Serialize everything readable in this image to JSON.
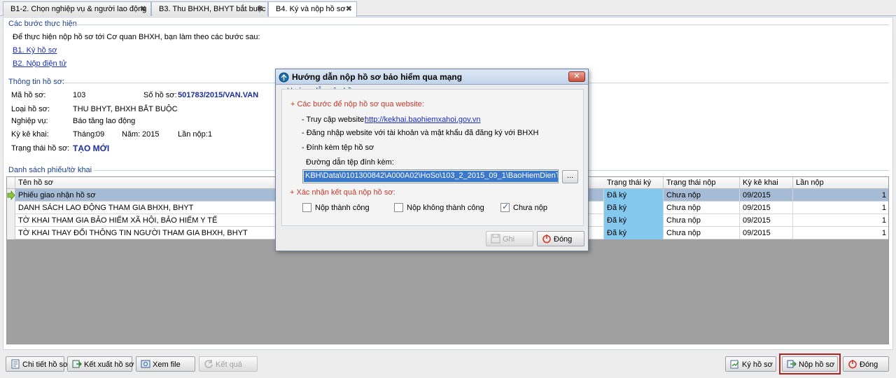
{
  "tabs": [
    {
      "label": "B1-2. Chọn nghiệp vụ & người lao động",
      "close": "✖"
    },
    {
      "label": "B3. Thu BHXH, BHYT bắt buộc",
      "close": "✖"
    },
    {
      "label": "B4. Ký và nộp hồ sơ",
      "close": "✖"
    }
  ],
  "steps": {
    "legend": "Các bước thực hiện",
    "intro": "Để thực hiện nộp hồ sơ tới Cơ quan BHXH, bạn làm theo các bước sau:",
    "step1": "B1. Ký hồ sơ",
    "step2": "B2. Nộp điện tử"
  },
  "info": {
    "legend": "Thông tin hồ sơ:",
    "ma_label": "Mã hồ sơ:",
    "ma_value": "103",
    "so_label": "Số hồ sơ:",
    "so_value": "501783/2015/VAN.VAN",
    "loai_label": "Loại hồ sơ:",
    "loai_value": "THU BHYT, BHXH BẮT BUỘC",
    "nv_label": "Nghiệp vụ:",
    "nv_value": "Báo tăng lao động",
    "ky_label": "Kỳ kê khai:",
    "thang_label": "Tháng:",
    "thang_value": "09",
    "nam_label": "Năm:",
    "nam_value": "2015",
    "lan_label": "Lần nộp:",
    "lan_value": "1",
    "tt_label": "Trạng thái hồ sơ:",
    "tt_value": "TẠO MỚI"
  },
  "list": {
    "legend": "Danh sách phiếu/tờ khai",
    "headers": {
      "name": "Tên hồ sơ",
      "ky": "Trạng thái ký",
      "nop": "Trạng thái nộp",
      "kykk": "Kỳ kê khai",
      "lan": "Lần nộp"
    },
    "rows": [
      {
        "name": "Phiếu giao nhận hồ sơ",
        "ky": "Đã ký",
        "nop": "Chưa nộp",
        "kykk": "09/2015",
        "lan": "1"
      },
      {
        "name": "DANH SÁCH LAO ĐỘNG THAM GIA BHXH, BHYT",
        "ky": "Đã ký",
        "nop": "Chưa nộp",
        "kykk": "09/2015",
        "lan": "1"
      },
      {
        "name": "TỜ KHAI THAM GIA BẢO HIỂM XÃ HỘI, BẢO HIỂM Y TẾ",
        "ky": "Đã ký",
        "nop": "Chưa nộp",
        "kykk": "09/2015",
        "lan": "1"
      },
      {
        "name": "TỜ KHAI THAY ĐỔI THÔNG TIN NGƯỜI THAM GIA BHXH, BHYT",
        "ky": "Đã ký",
        "nop": "Chưa nộp",
        "kykk": "09/2015",
        "lan": "1"
      }
    ]
  },
  "toolbar": {
    "chitiet": "Chi tiết hồ sơ",
    "ketxuat": "Kết xuất hồ sơ",
    "xemfile": "Xem file",
    "ketqua": "Kết quả",
    "kyhoso": "Ký hồ sơ",
    "nophoso": "Nộp hồ sơ",
    "dong": "Đóng"
  },
  "dialog": {
    "title": "Hướng dẫn nộp hồ sơ bảo hiểm qua mạng",
    "close": "✕",
    "legend": "Hướng dẫn nộp hồ sơ",
    "section1": "+ Các bước để nộp hồ sơ qua website:",
    "access_label": "- Truy cập website:",
    "access_url": "http://kekhai.baohiemxahoi.gov.vn",
    "login": "- Đăng nhập website với tài khoản và mật khẩu đã đăng ký với BHXH",
    "attach": "- Đính kèm tệp hồ sơ",
    "path_label": "Đường dẫn tệp đính kèm:",
    "path_value": "KBH\\Data\\0101300842\\A000A02\\HoSo\\103_2_2015_09_1\\BaoHiemDienTu.xml",
    "browse": "...",
    "section2": "+ Xác nhận kết quả nộp hồ sơ:",
    "cb1": "Nộp thành công",
    "cb2": "Nộp không thành công",
    "cb3": "Chưa nộp",
    "ghi": "Ghi",
    "dong": "Đóng"
  },
  "colors": {
    "accent": "#1a3f8e",
    "selected_row": "#a6bcd6",
    "signed_cell": "#85c8ed",
    "highlight_border": "#b22222"
  }
}
